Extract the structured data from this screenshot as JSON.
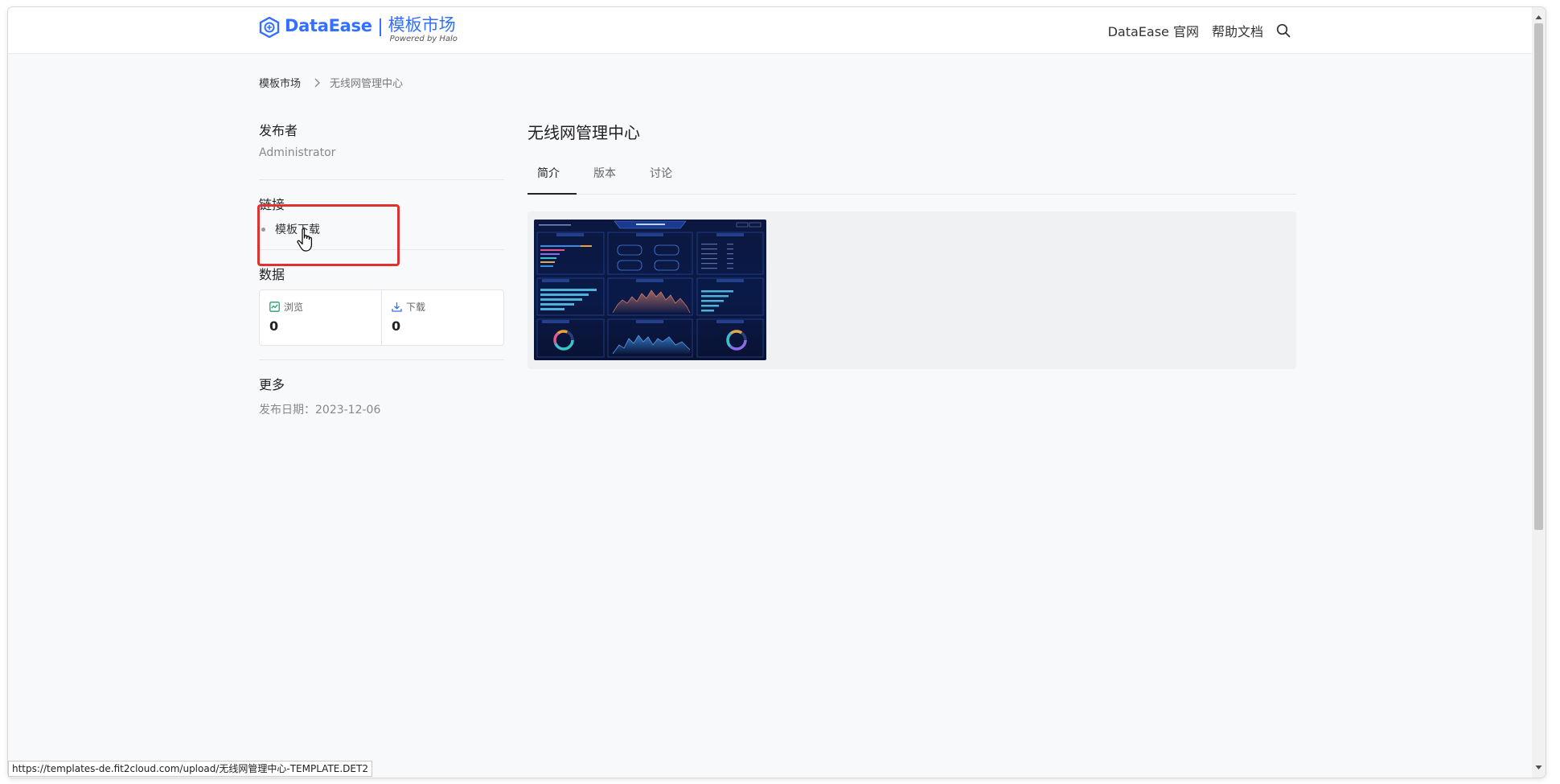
{
  "header": {
    "logo_text": "DataEase",
    "logo_cn": "模板市场",
    "powered_by": "Powered by Halo",
    "nav_official": "DataEase 官网",
    "nav_docs": "帮助文档"
  },
  "breadcrumb": {
    "home": "模板市场",
    "current": "无线网管理中心"
  },
  "sidebar": {
    "publisher_title": "发布者",
    "publisher_name": "Administrator",
    "links_title": "链接",
    "links": [
      "模板下载"
    ],
    "data_title": "数据",
    "views_label": "浏览",
    "views_value": "0",
    "downloads_label": "下载",
    "downloads_value": "0",
    "more_title": "更多",
    "publish_date": "发布日期：2023-12-06"
  },
  "main": {
    "title": "无线网管理中心",
    "tabs": [
      {
        "label": "简介",
        "active": true
      },
      {
        "label": "版本",
        "active": false
      },
      {
        "label": "讨论",
        "active": false
      }
    ]
  },
  "status_bar": {
    "url": "https://templates-de.fit2cloud.com/upload/无线网管理中心-TEMPLATE.DET2"
  },
  "colors": {
    "brand": "#3370ff",
    "highlight": "#e03131",
    "views_icon": "#22a06b",
    "download_icon": "#3370ff"
  }
}
